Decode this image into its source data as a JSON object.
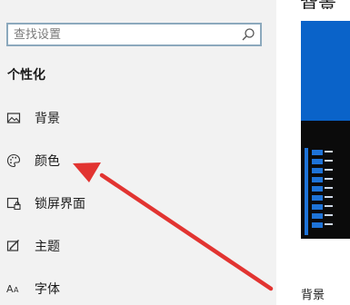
{
  "search": {
    "placeholder": "查找设置"
  },
  "section": {
    "title": "个性化"
  },
  "nav": {
    "items": [
      {
        "label": "背景",
        "icon": "image-icon"
      },
      {
        "label": "颜色",
        "icon": "palette-icon"
      },
      {
        "label": "锁屏界面",
        "icon": "lock-screen-icon"
      },
      {
        "label": "主题",
        "icon": "theme-icon"
      },
      {
        "label": "字体",
        "icon": "font-icon"
      }
    ]
  },
  "header": {
    "title": "背景"
  },
  "preview": {
    "background_label": "背景"
  },
  "colors": {
    "sidebar_bg": "#f2f2f2",
    "search_border": "#8ca9bd",
    "preview_blue": "#0a63c9",
    "taskbar_dark": "#0b0b0b",
    "accent_bars": "#1e73d8",
    "arrow_red": "#e23431"
  }
}
